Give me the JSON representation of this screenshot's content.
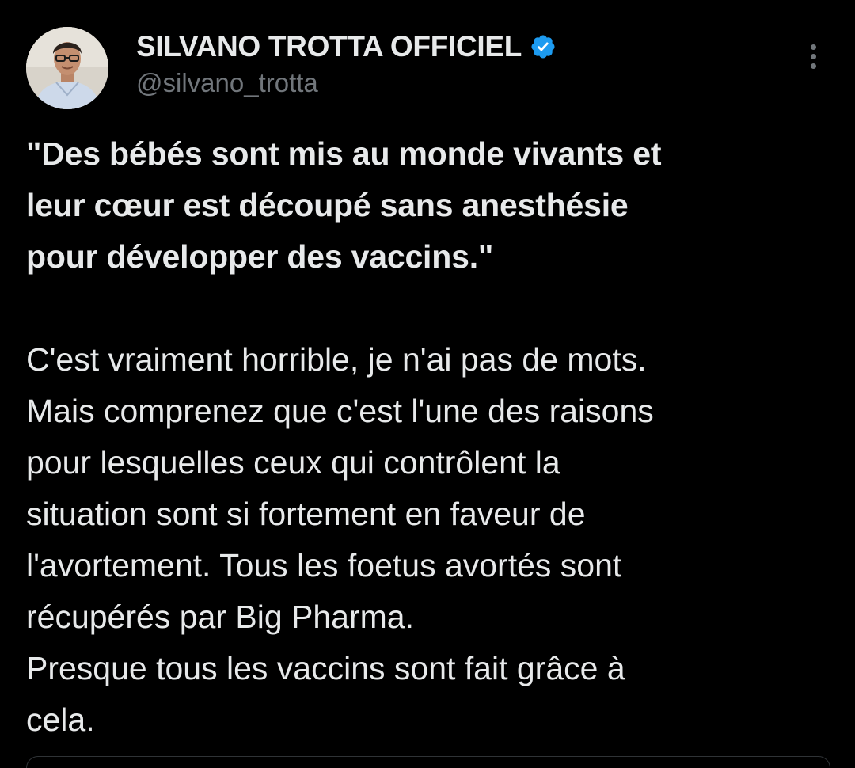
{
  "author": {
    "display_name": "SILVANO TROTTA OFFICIEL",
    "handle": "@silvano_trotta",
    "verified_icon": "verified-badge-icon",
    "verified_color": "#1d9bf0"
  },
  "menu": {
    "icon": "more-vertical-icon"
  },
  "tweet": {
    "quote_lines": [
      "\"Des bébés sont mis au monde vivants et",
      "leur cœur est découpé sans anesthésie",
      "pour développer des vaccins.\""
    ],
    "body_lines": [
      "C'est vraiment horrible, je n'ai pas de mots.",
      "Mais comprenez que c'est l'une des raisons",
      "pour lesquelles ceux qui contrôlent la",
      "situation sont si fortement en faveur de",
      "l'avortement. Tous les foetus avortés sont",
      "récupérés par Big Pharma.",
      "Presque tous les vaccins sont fait grâce à",
      "cela."
    ]
  },
  "colors": {
    "background": "#000000",
    "text": "#e7e9ea",
    "secondary_text": "#71767b",
    "border": "#2f3336"
  }
}
